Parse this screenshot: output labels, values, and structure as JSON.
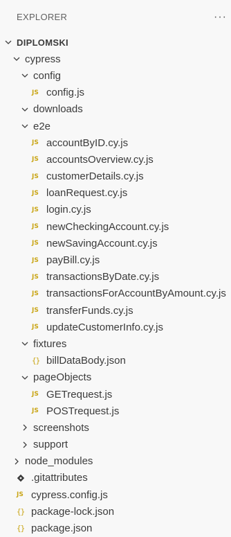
{
  "header": {
    "title": "EXPLORER",
    "more": "···"
  },
  "tree": {
    "root": "DIPLOMSKI",
    "cypress": "cypress",
    "config": "config",
    "config_js": "config.js",
    "downloads": "downloads",
    "e2e": "e2e",
    "e2e_files": [
      "accountByID.cy.js",
      "accountsOverview.cy.js",
      "customerDetails.cy.js",
      "loanRequest.cy.js",
      "login.cy.js",
      "newCheckingAccount.cy.js",
      "newSavingAccount.cy.js",
      "payBill.cy.js",
      "transactionsByDate.cy.js",
      "transactionsForAccountByAmount.cy.js",
      "transferFunds.cy.js",
      "updateCustomerInfo.cy.js"
    ],
    "fixtures": "fixtures",
    "bill_json": "billDataBody.json",
    "pageObjects": "pageObjects",
    "get_request": "GETrequest.js",
    "post_request": "POSTrequest.js",
    "screenshots": "screenshots",
    "support": "support",
    "node_modules": "node_modules",
    "gitattributes": ".gitattributes",
    "cypress_config": "cypress.config.js",
    "package_lock": "package-lock.json",
    "package_json": "package.json"
  },
  "icons": {
    "js_badge": "JS",
    "json_badge": "{}"
  },
  "colors": {
    "js_icon": "#c9a515",
    "git_icon": "#3a3a3a",
    "background": "#f8f8f8"
  }
}
